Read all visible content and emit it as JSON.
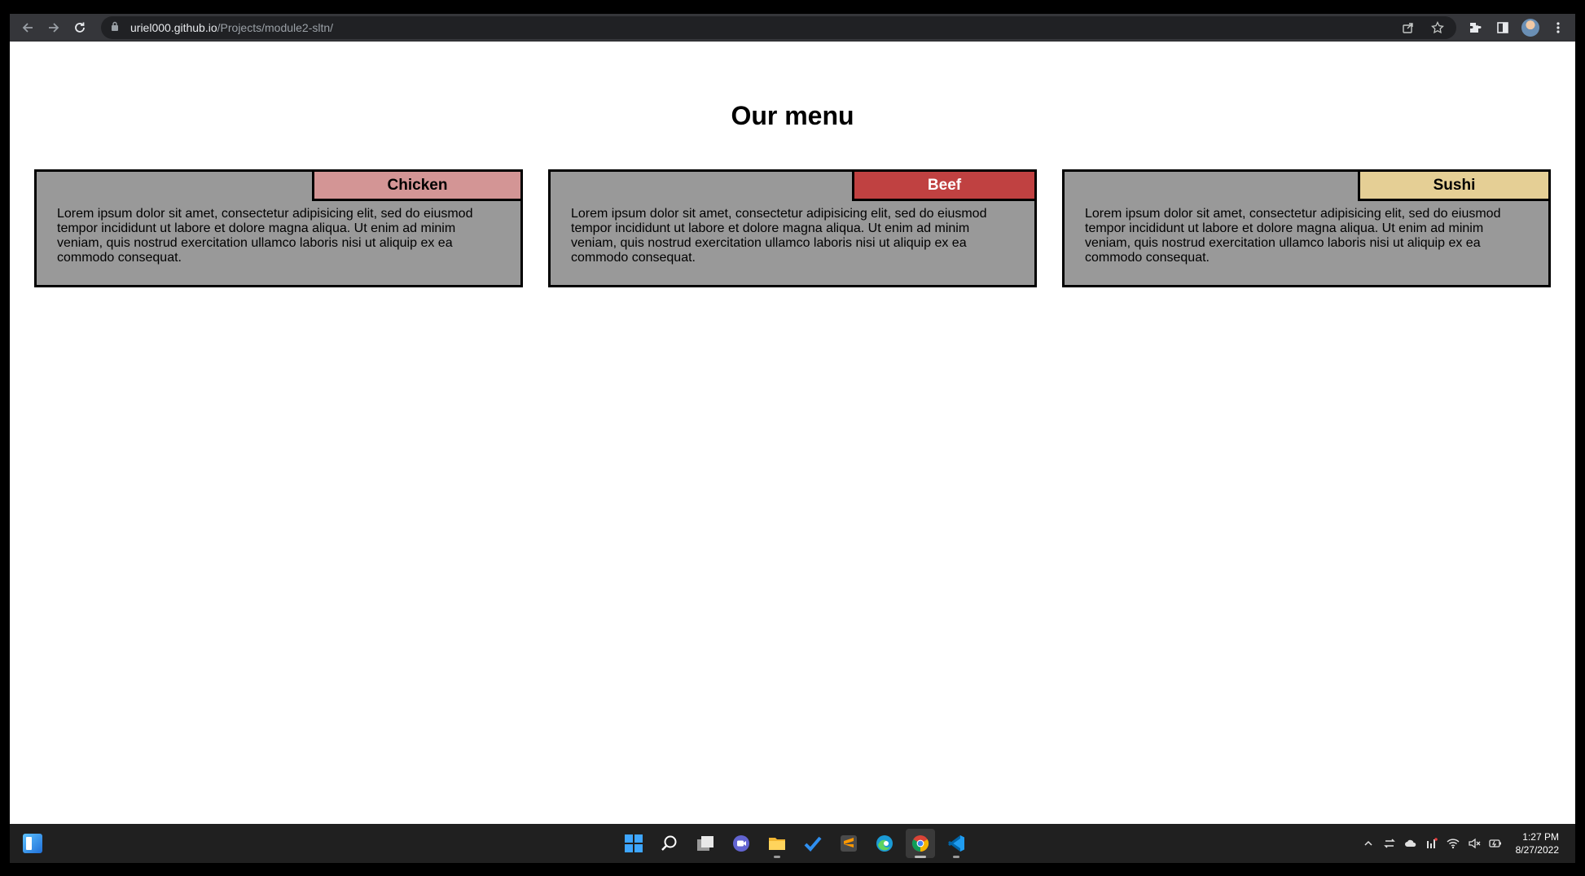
{
  "browser": {
    "url_host": "uriel000.github.io",
    "url_path": "/Projects/module2-sltn/"
  },
  "page": {
    "title": "Our menu",
    "cards": [
      {
        "label": "Chicken",
        "label_bg": "#d39595",
        "label_color": "#000000",
        "text": "Lorem ipsum dolor sit amet, consectetur adipisicing elit, sed do eiusmod tempor incididunt ut labore et dolore magna aliqua. Ut enim ad minim veniam, quis nostrud exercitation ullamco laboris nisi ut aliquip ex ea commodo consequat."
      },
      {
        "label": "Beef",
        "label_bg": "#c04141",
        "label_color": "#ffffff",
        "text": "Lorem ipsum dolor sit amet, consectetur adipisicing elit, sed do eiusmod tempor incididunt ut labore et dolore magna aliqua. Ut enim ad minim veniam, quis nostrud exercitation ullamco laboris nisi ut aliquip ex ea commodo consequat."
      },
      {
        "label": "Sushi",
        "label_bg": "#e5cf95",
        "label_color": "#000000",
        "text": "Lorem ipsum dolor sit amet, consectetur adipisicing elit, sed do eiusmod tempor incididunt ut labore et dolore magna aliqua. Ut enim ad minim veniam, quis nostrud exercitation ullamco laboris nisi ut aliquip ex ea commodo consequat."
      }
    ],
    "card_bg": "#999999"
  },
  "taskbar": {
    "apps": [
      "start-icon",
      "search-icon",
      "task-view-icon",
      "teams-chat-icon",
      "file-explorer-icon",
      "todo-icon",
      "sublime-text-icon",
      "edge-icon",
      "chrome-icon",
      "vscode-icon"
    ],
    "time": "1:27 PM",
    "date": "8/27/2022"
  }
}
